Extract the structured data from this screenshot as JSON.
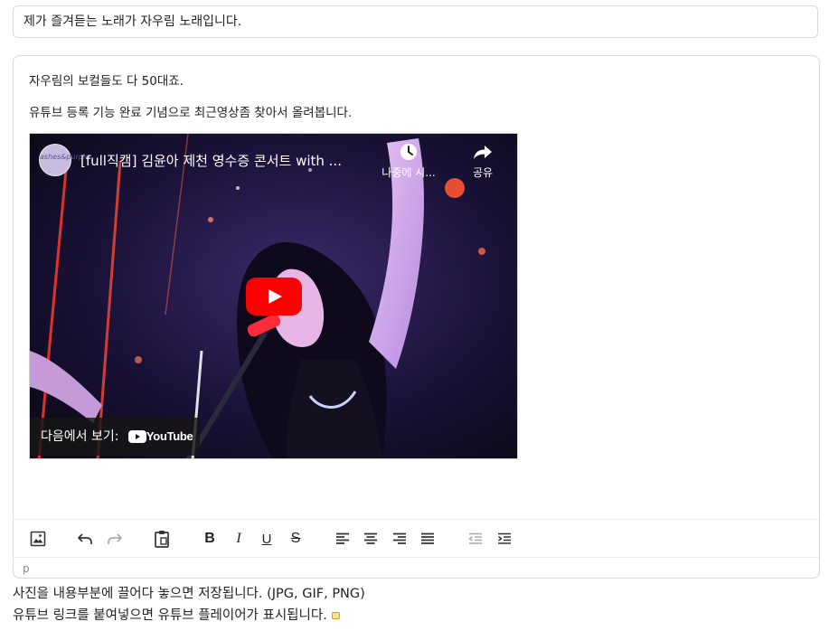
{
  "title_field": {
    "value": "제가 즐겨듣는 노래가 자우림 노래입니다."
  },
  "editor": {
    "paragraphs": [
      "자우림의 보컬들도 다 50대죠.",
      "유튜브 등록 기능 완료 기념으로 최근영상좀 찾아서 올려봅니다."
    ],
    "video": {
      "title": "[full직캠] 김윤아 제천 영수증 콘서트 with ...",
      "channel_avatar_text": "ashes&purple",
      "watch_later_label": "나중에 시...",
      "share_label": "공유",
      "watch_on_label": "다음에서 보기:",
      "youtube_brand": "YouTube",
      "icons": {
        "watch_later": "clock-icon",
        "share": "share-arrow-icon",
        "play": "play-icon"
      },
      "colors": {
        "play_button": "#ff0000"
      }
    },
    "toolbar": {
      "buttons": [
        "image-icon",
        "undo-icon",
        "redo-icon",
        "paste-icon",
        "bold-icon",
        "italic-icon",
        "underline-icon",
        "strikethrough-icon",
        "align-left-icon",
        "align-center-icon",
        "align-right-icon",
        "align-justify-icon",
        "outdent-icon",
        "indent-icon"
      ],
      "bold_label": "B",
      "italic_label": "I",
      "underline_label": "U",
      "strike_label": "S"
    },
    "status_path": "p"
  },
  "help": {
    "line1": "사진을 내용부분에 끌어다 놓으면 저장됩니다. (JPG, GIF, PNG)",
    "line2": "유튜브 링크를 붙여넣으면 유튜브 플레이어가 표시됩니다."
  }
}
